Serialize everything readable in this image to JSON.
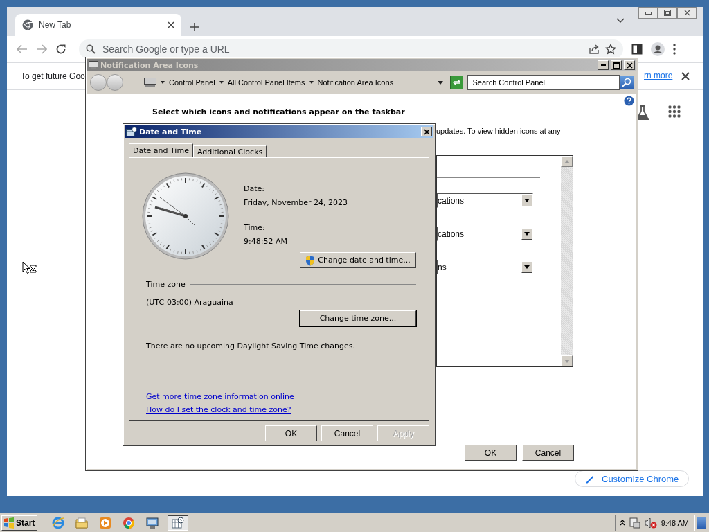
{
  "browser": {
    "tabs": [
      {
        "title": "New Tab",
        "selected": true
      }
    ],
    "omnibox": {
      "placeholder": "Search Google or type a URL"
    },
    "infobar": {
      "text": "To get future Goo",
      "link": "rn more"
    },
    "customize_button": "Customize Chrome"
  },
  "notification_window": {
    "title": "Notification Area Icons",
    "breadcrumb": [
      "Control Panel",
      "All Control Panel Items",
      "Notification Area Icons"
    ],
    "search": {
      "placeholder": "Search Control Panel"
    },
    "heading": "Select which icons and notifications appear on the taskbar",
    "description": "updates. To view hidden icons at any",
    "combos": [
      {
        "value": "cations"
      },
      {
        "value": "cations"
      },
      {
        "value": "ns"
      }
    ],
    "buttons": [
      "OK",
      "Cancel"
    ]
  },
  "date_time_dialog": {
    "title": "Date and Time",
    "tabs": [
      {
        "label": "Date and Time",
        "selected": true
      },
      {
        "label": "Additional Clocks",
        "selected": false
      }
    ],
    "date_label": "Date:",
    "date": "Friday, November 24, 2023",
    "time_label": "Time:",
    "time": "9:48:52 AM",
    "change_date_button": "Change date and time...",
    "time_zone_label": "Time zone",
    "time_zone": "(UTC-03:00) Araguaina",
    "change_zone_button": "Change time zone...",
    "dst_note": "There are no upcoming Daylight Saving Time changes.",
    "links": [
      "Get more time zone information online",
      "How do I set the clock and time zone?"
    ],
    "buttons": [
      {
        "label": "OK",
        "disabled": false
      },
      {
        "label": "Cancel",
        "disabled": false
      },
      {
        "label": "Apply",
        "disabled": true
      }
    ]
  },
  "taskbar": {
    "start": "Start",
    "apps": [
      {
        "kind": "browser",
        "selected": false
      },
      {
        "kind": "folder",
        "selected": false
      },
      {
        "kind": "media",
        "selected": false
      },
      {
        "kind": "chrome",
        "selected": false
      },
      {
        "kind": "remote",
        "selected": false
      },
      {
        "kind": "clock",
        "selected": true
      }
    ],
    "clock": "9:48 AM"
  }
}
